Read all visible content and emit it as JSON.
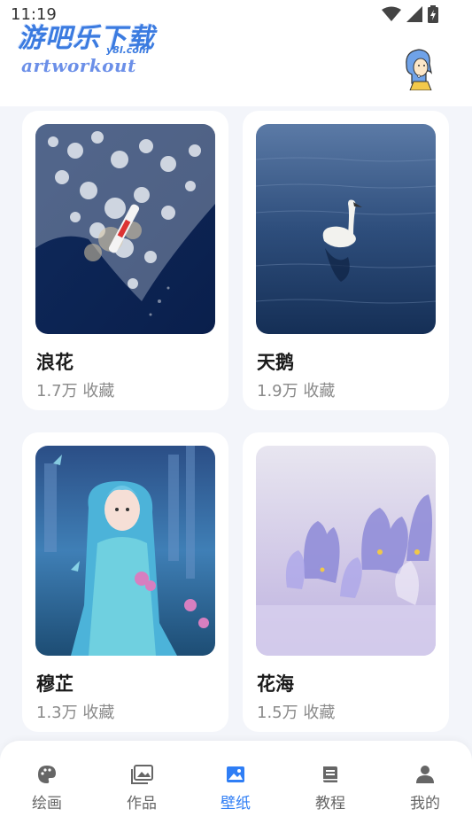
{
  "status": {
    "time": "11:19"
  },
  "watermark": {
    "main": "游吧乐下载",
    "sub": "y8l.com"
  },
  "app": {
    "logo_text": "artworkout"
  },
  "colors": {
    "accent": "#2f7ef5",
    "muted": "#666666"
  },
  "wallpapers": [
    {
      "title": "浪花",
      "meta": "1.7万 收藏",
      "image": "ocean-waves-boat"
    },
    {
      "title": "天鹅",
      "meta": "1.9万 收藏",
      "image": "swan-on-water"
    },
    {
      "title": "穆芷",
      "meta": "1.3万 收藏",
      "image": "blue-haired-girl"
    },
    {
      "title": "花海",
      "meta": "1.5万 收藏",
      "image": "purple-crocus-flowers"
    }
  ],
  "tabs": [
    {
      "label": "绘画",
      "icon": "palette-icon"
    },
    {
      "label": "作品",
      "icon": "gallery-icon"
    },
    {
      "label": "壁纸",
      "icon": "image-icon",
      "active": true
    },
    {
      "label": "教程",
      "icon": "book-icon"
    },
    {
      "label": "我的",
      "icon": "person-icon"
    }
  ]
}
